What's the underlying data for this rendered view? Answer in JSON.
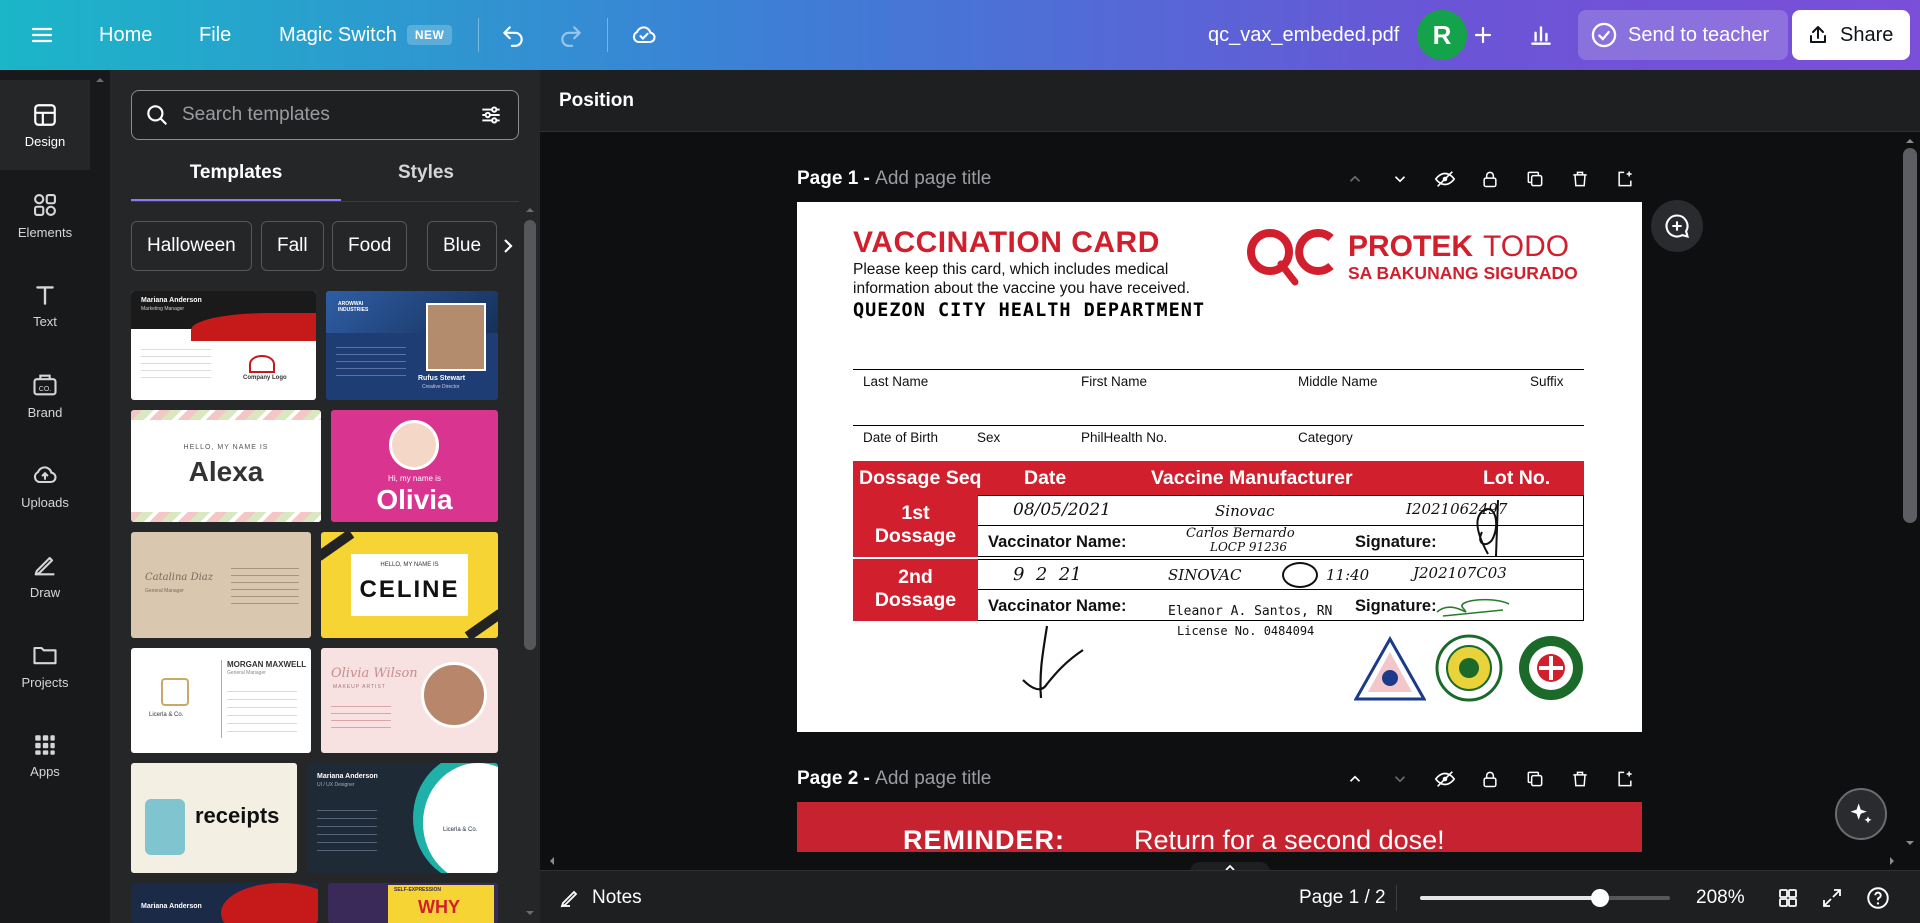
{
  "topbar": {
    "home": "Home",
    "file": "File",
    "magic_switch": "Magic Switch",
    "new_badge": "NEW",
    "doc_title": "qc_vax_embeded.pdf",
    "avatar_initial": "R",
    "send_to_teacher": "Send to teacher",
    "share": "Share"
  },
  "rail": {
    "design": "Design",
    "elements": "Elements",
    "text": "Text",
    "brand": "Brand",
    "uploads": "Uploads",
    "draw": "Draw",
    "projects": "Projects",
    "apps": "Apps"
  },
  "panel": {
    "search_placeholder": "Search templates",
    "tabs": [
      "Templates",
      "Styles"
    ],
    "chips": [
      "Halloween",
      "Fall",
      "Food",
      "Blue"
    ],
    "templates": [
      {
        "name": "Mariana Anderson",
        "subtitle": "Marketing Manager",
        "extra": "Company Logo",
        "bg": "#ffffff"
      },
      {
        "name": "Rufus Stewart",
        "subtitle": "Creative Director",
        "extra": "AROWWAI INDUSTRIES",
        "bg": "#1f3d75"
      },
      {
        "name": "Alexa",
        "subtitle": "HELLO, MY NAME IS",
        "bg": "#ffffff"
      },
      {
        "name": "Olivia",
        "subtitle": "Hi, my name is",
        "bg": "#d9348f"
      },
      {
        "name": "Catalina Diaz",
        "subtitle": "General Manager",
        "bg": "#d9c7b0"
      },
      {
        "name": "CELINE",
        "subtitle": "HELLO, MY NAME IS",
        "bg": "#f5d433"
      },
      {
        "name": "MORGAN MAXWELL",
        "subtitle": "General Manager",
        "extra": "Licerla & Co.",
        "bg": "#ffffff"
      },
      {
        "name": "Olivia Wilson",
        "subtitle": "MAKEUP ARTIST",
        "bg": "#f7e1e1"
      },
      {
        "name": "receipts",
        "bg": "#f4efe3"
      },
      {
        "name": "Mariana Anderson",
        "subtitle": "UI / UX Designer",
        "extra": "Licerla & Co.",
        "bg": "#1e2a36"
      },
      {
        "name": "Mariana Anderson",
        "bg": "#1b2a46"
      },
      {
        "name": "WHY",
        "subtitle": "SELF-EXPRESSION",
        "bg": "#3a2a5a"
      }
    ]
  },
  "context": {
    "position": "Position"
  },
  "page1": {
    "label": "Page 1 -",
    "placeholder": "Add page title"
  },
  "page2": {
    "label": "Page 2 -",
    "placeholder": "Add page title",
    "reminder": "REMINDER:",
    "reminder_text": "Return for a second dose!"
  },
  "card": {
    "title": "VACCINATION CARD",
    "note": "Please keep this card, which includes medical information about the vaccine you have received.",
    "dept": "QUEZON CITY HEALTH DEPARTMENT",
    "logo_qc": "QC",
    "logo_protek": "PROTEK",
    "logo_todo": "TODO",
    "logo_sub": "SA BAKUNANG SIGURADO",
    "fields_row1": [
      "Last Name",
      "First Name",
      "Middle Name",
      "Suffix"
    ],
    "fields_row2": [
      "Date of Birth",
      "Sex",
      "PhilHealth No.",
      "Category"
    ],
    "table_headers": [
      "Dossage Seq",
      "Date",
      "Vaccine Manufacturer",
      "Lot No."
    ],
    "doses": [
      {
        "seq_line1": "1st",
        "seq_line2": "Dossage",
        "vaccinator_label": "Vaccinator Name:",
        "signature_label": "Signature:",
        "hw_date": "08/05/2021",
        "hw_maker": "Sinovac",
        "hw_lot": "I2021062497",
        "hw_name": "Carlos Bernardo",
        "hw_name2": "LOCP 91236"
      },
      {
        "seq_line1": "2nd",
        "seq_line2": "Dossage",
        "vaccinator_label": "Vaccinator Name:",
        "signature_label": "Signature:",
        "hw_date": "9  2  21",
        "hw_maker": "SINOVAC",
        "hw_time": "11:40",
        "hw_lot": "J202107C03",
        "hw_name": "Eleanor A. Santos, RN",
        "hw_name2": "License No. 0484094"
      }
    ]
  },
  "bottombar": {
    "notes": "Notes",
    "page_indicator": "Page 1 / 2",
    "zoom": "208%",
    "zoom_level": 0.72
  },
  "colors": {
    "accent": "#8b7cf6",
    "card_red": "#d11f2d",
    "avatar_green": "#14a24a"
  }
}
